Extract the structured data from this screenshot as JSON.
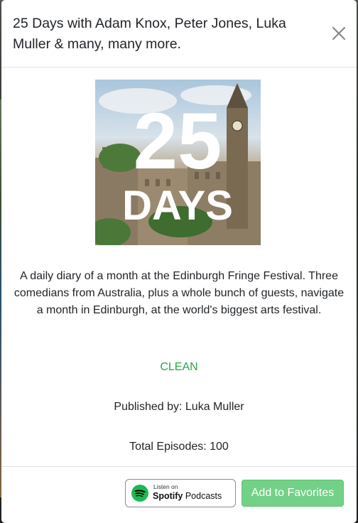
{
  "modal": {
    "title": "25 Days with Adam Knox, Peter Jones, Luka Muller & many, many more.",
    "close_label": "×"
  },
  "podcast": {
    "cover_text_number": "25",
    "cover_text_word": "DAYS",
    "description": "A daily diary of a month at the Edinburgh Fringe Festival. Three comedians from Australia, plus a whole bunch of guests, navigate a month in Edinburgh, at the world's biggest arts festival.",
    "rating": "CLEAN",
    "publisher_line": "Published by: Luka Muller",
    "episodes_line": "Total Episodes: 100"
  },
  "footer": {
    "spotify_listen": "Listen on",
    "spotify_brand": "Spotify",
    "spotify_suffix": "Podcasts",
    "favorites_label": "Add to Favorites"
  },
  "colors": {
    "rating_green": "#28a745",
    "favorites_button": "#72d186",
    "spotify_green": "#1db954"
  },
  "icons": [
    "close-icon",
    "spotify-icon"
  ]
}
